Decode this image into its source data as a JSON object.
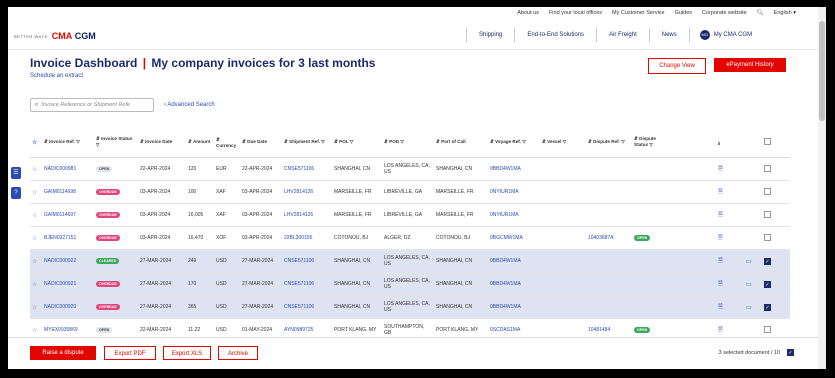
{
  "top_links": [
    "About us",
    "Find your local offices",
    "My Customer Service",
    "Guides",
    "Corporate website",
    "English ▾"
  ],
  "logo": {
    "tagline": "BETTER WAYS",
    "brand_a": "CMA",
    "brand_b": " CGM"
  },
  "nav": {
    "items": [
      "Shipping",
      "End-to-End Solutions",
      "Air Freight",
      "News"
    ],
    "my_account": "My CMA CGM",
    "avatar": "MO"
  },
  "page": {
    "title_a": "Invoice Dashboard",
    "title_sep": "|",
    "title_b": "My company invoices for 3 last months",
    "subtitle": "Schedule an extract",
    "change_view": "Change View",
    "payment_history": "ePayment History"
  },
  "search": {
    "placeholder": "Invoice Reference or Shipment Refe",
    "advanced": "Advanced Search"
  },
  "table": {
    "headers": [
      "Invoice Ref.",
      "Invoice Status",
      "Invoice Date",
      "Amount",
      "Currency",
      "Due Date",
      "Shipment Ref.",
      "POL",
      "POD",
      "Port of Call",
      "Voyage Ref.",
      "Vessel",
      "Dispute Ref.",
      "Dispute Status"
    ],
    "rows": [
      {
        "ref": "NADIC000981",
        "status": "OPEN",
        "status_color": "#dfe3ea",
        "status_text_color": "#444",
        "date": "22-APR-2024",
        "amount": "120",
        "currency": "EUR",
        "due": "22-APR-2024",
        "shipment": "CNSE571106",
        "pol": "SHANGHAI, CN",
        "pod": "LOS ANGELES, CA, US",
        "poc": "SHANGHAI, CN",
        "voyage": "0BBD4W1MA",
        "vessel": "",
        "dispute": "",
        "dispute_status": "",
        "dispute_color": "",
        "selected": false,
        "checked": false
      },
      {
        "ref": "GAIM0114698",
        "status": "OVERDUE",
        "status_color": "#e0457b",
        "status_text_color": "#fff",
        "date": "03-APR-2024",
        "amount": "100",
        "currency": "XAF",
        "due": "03-APR-2024",
        "shipment": "LHV2814126",
        "pol": "MARSEILLE, FR",
        "pod": "LIBREVILLE, GA",
        "poc": "MARSEILLE, FR",
        "voyage": "0NYIUR1MA",
        "vessel": "",
        "dispute": "",
        "dispute_status": "",
        "dispute_color": "",
        "selected": false,
        "checked": false
      },
      {
        "ref": "GAIM0114697",
        "status": "OVERDUE",
        "status_color": "#e0457b",
        "status_text_color": "#fff",
        "date": "03-APR-2024",
        "amount": "16,005",
        "currency": "XAF",
        "due": "03-APR-2024",
        "shipment": "LHV2814126",
        "pol": "MARSEILLE, FR",
        "pod": "LIBREVILLE, GA",
        "poc": "MARSEILLE, FR",
        "voyage": "0NYIUR1MA",
        "vessel": "",
        "dispute": "",
        "dispute_status": "",
        "dispute_color": "",
        "selected": false,
        "checked": false
      },
      {
        "ref": "BJEN0327151",
        "status": "OVERDUE",
        "status_color": "#e0457b",
        "status_text_color": "#fff",
        "date": "03-APR-2024",
        "amount": "16,470",
        "currency": "XOF",
        "due": "03-APR-2024",
        "shipment": "22BL300156",
        "pol": "COTONOU, BJ",
        "pod": "ALGER, DZ",
        "poc": "COTONOU, BJ",
        "voyage": "0BGCMW1MA",
        "vessel": "",
        "dispute": "10403687A",
        "dispute_status": "OPEN",
        "dispute_color": "#3aaa5a",
        "selected": false,
        "checked": false
      },
      {
        "ref": "NADIC000922",
        "status": "CLEARED",
        "status_color": "#3aaa5a",
        "status_text_color": "#fff",
        "date": "27-MAR-2024",
        "amount": "249",
        "currency": "USD",
        "due": "27-MAR-2024",
        "shipment": "CNSE571106",
        "pol": "SHANGHAI, CN",
        "pod": "LOS ANGELES, CA, US",
        "poc": "SHANGHAI, CN",
        "voyage": "0BBD4W1MA",
        "vessel": "",
        "dispute": "",
        "dispute_status": "",
        "dispute_color": "",
        "selected": true,
        "checked": true
      },
      {
        "ref": "NADIC000921",
        "status": "OVERDUE",
        "status_color": "#e0457b",
        "status_text_color": "#fff",
        "date": "27-MAR-2024",
        "amount": "170",
        "currency": "USD",
        "due": "27-MAR-2024",
        "shipment": "CNSE571106",
        "pol": "SHANGHAI, CN",
        "pod": "LOS ANGELES, CA, US",
        "poc": "SHANGHAI, CN",
        "voyage": "0BBD4W1MA",
        "vessel": "",
        "dispute": "",
        "dispute_status": "",
        "dispute_color": "",
        "selected": true,
        "checked": true
      },
      {
        "ref": "NADIC000920",
        "status": "OVERDUE",
        "status_color": "#e0457b",
        "status_text_color": "#fff",
        "date": "27-MAR-2024",
        "amount": "365",
        "currency": "USD",
        "due": "27-MAR-2024",
        "shipment": "CNSE571106",
        "pol": "SHANGHAI, CN",
        "pod": "LOS ANGELES, CA, US",
        "poc": "SHANGHAI, CN",
        "voyage": "0BBD4W1MA",
        "vessel": "",
        "dispute": "",
        "dispute_status": "",
        "dispute_color": "",
        "selected": true,
        "checked": true
      },
      {
        "ref": "MYEX0935869",
        "status": "OPEN",
        "status_color": "#dfe3ea",
        "status_text_color": "#444",
        "date": "22-MAR-2024",
        "amount": "11.22",
        "currency": "USD",
        "due": "01-MAY-2024",
        "shipment": "AYN0989725",
        "pol": "PORT KLANG, MY",
        "pod": "SOUTHAMPTON, GB",
        "poc": "PORT KLANG, MY",
        "voyage": "0SCDAS1MA",
        "vessel": "",
        "dispute": "10481484",
        "dispute_status": "OPEN",
        "dispute_color": "#3aaa5a",
        "selected": false,
        "checked": false
      }
    ]
  },
  "bottom": {
    "raise_dispute": "Raise a dispute",
    "export_pdf": "Export PDF",
    "export_xls": "Export XLS",
    "archive": "Archive",
    "selected_count": "3 selected document / 10"
  },
  "colors": {
    "brand_red": "#e10600",
    "brand_navy": "#1b2a6b",
    "link_blue": "#2a4bb3",
    "selected_row": "#dde3f0"
  }
}
